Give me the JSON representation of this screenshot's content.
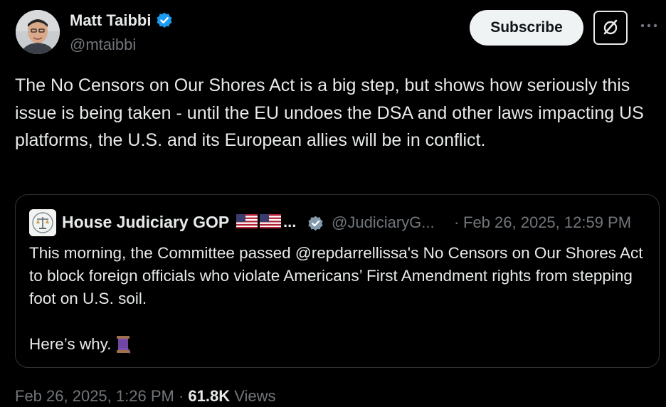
{
  "author": {
    "name": "Matt Taibbi",
    "handle": "@mtaibbi",
    "verified_color": "#1d9bf0"
  },
  "actions": {
    "subscribe_label": "Subscribe",
    "grok_icon": "grok-icon",
    "more_icon": "more-icon"
  },
  "tweet": {
    "text": "The No Censors on Our Shores Act is a big step, but shows how seriously this issue is being taken - until the EU undoes the DSA and other laws impacting US platforms, the U.S. and its European allies will be in conflict."
  },
  "quoted": {
    "name": "House Judiciary GOP",
    "name_suffix": "...",
    "flags": [
      "us-flag-icon",
      "us-flag-icon"
    ],
    "handle": "@JudiciaryG...",
    "separator": "·",
    "date": "Feb 26, 2025, 12:59 PM",
    "text": "This morning, the Committee passed @repdarrellissa's  No Censors on Our Shores Act to block foreign officials who violate Americans’ First Amendment rights from stepping foot on U.S. soil.",
    "text2": "Here’s why.",
    "emoji": "thread-spool-icon"
  },
  "footer": {
    "timestamp": "Feb 26, 2025, 1:26 PM",
    "separator": "·",
    "views_count": "61.8K",
    "views_label": "Views"
  },
  "colors": {
    "background": "#000000",
    "text": "#e7e9ea",
    "muted": "#71767b",
    "border": "#2f3336"
  }
}
